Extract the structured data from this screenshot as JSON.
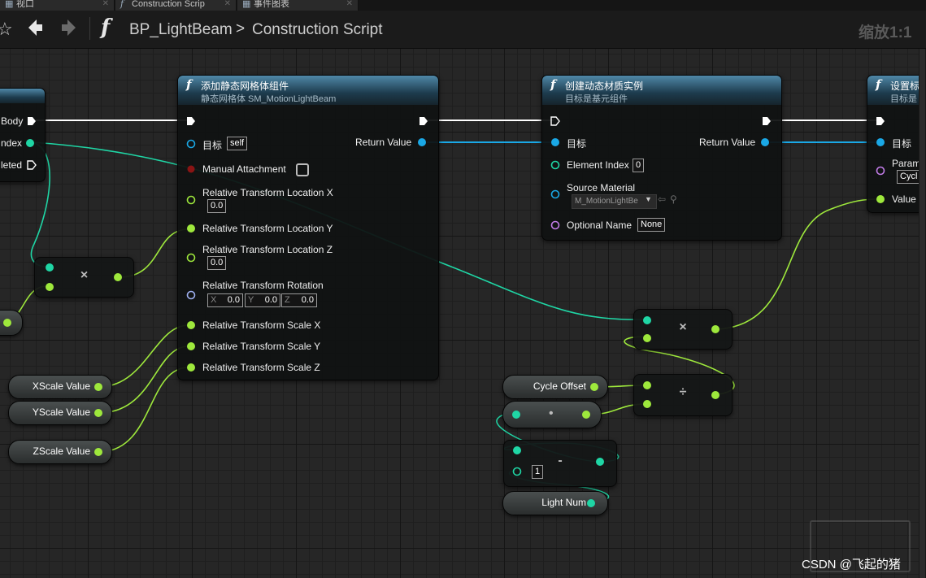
{
  "tabs": [
    {
      "label": "视口"
    },
    {
      "label": "Construction Scrip"
    },
    {
      "label": "事件图表"
    }
  ],
  "toolbar": {
    "function_symbol": "f",
    "breadcrumb_root": "BP_LightBeam",
    "breadcrumb_sep": ">",
    "breadcrumb_current": "Construction Script",
    "zoom": "缩放1:1"
  },
  "node_left": {
    "pin_body": "Body",
    "pin_index": "ndex",
    "pin_completed": "leted"
  },
  "node_add": {
    "title": "添加静态网格体组件",
    "subtitle": "静态网格体 SM_MotionLightBeam",
    "target": "目标",
    "target_value": "self",
    "return": "Return Value",
    "manual_attachment": "Manual Attachment",
    "loc_x": "Relative Transform Location X",
    "loc_x_value": "0.0",
    "loc_y": "Relative Transform Location Y",
    "loc_z": "Relative Transform Location Z",
    "loc_z_value": "0.0",
    "rotation": "Relative Transform Rotation",
    "rot_x_label": "X",
    "rot_x": "0.0",
    "rot_y_label": "Y",
    "rot_y": "0.0",
    "rot_z_label": "Z",
    "rot_z": "0.0",
    "scale_x": "Relative Transform Scale X",
    "scale_y": "Relative Transform Scale Y",
    "scale_z": "Relative Transform Scale Z"
  },
  "node_mat": {
    "title": "创建动态材质实例",
    "subtitle": "目标是基元组件",
    "target": "目标",
    "return": "Return Value",
    "element_index": "Element Index",
    "element_index_value": "0",
    "source_material": "Source Material",
    "source_material_value": "M_MotionLightBe",
    "optional_name": "Optional Name",
    "optional_name_value": "None"
  },
  "node_set": {
    "title": "设置标",
    "subtitle": "目标是",
    "target": "目标",
    "param": "Param",
    "param_value": "Cycl",
    "value": "Value"
  },
  "variables": {
    "xscale": "XScale Value",
    "yscale": "YScale Value",
    "zscale": "ZScale Value",
    "cycle_offset": "Cycle Offset",
    "light_num": "Light Num",
    "minus_literal": "1"
  },
  "operators": {
    "multiply": "×",
    "divide": "÷",
    "modulo": "•",
    "subtract": "-"
  },
  "watermark": {
    "text": "CSDN @飞起的猪"
  },
  "colors": {
    "exec": "#ffffff",
    "object": "#1aa8e6",
    "float": "#9ee83c",
    "int": "#1fd6a5",
    "name": "#c27ce8",
    "rotator": "#9fb0f0",
    "bool": "#8a1414"
  }
}
